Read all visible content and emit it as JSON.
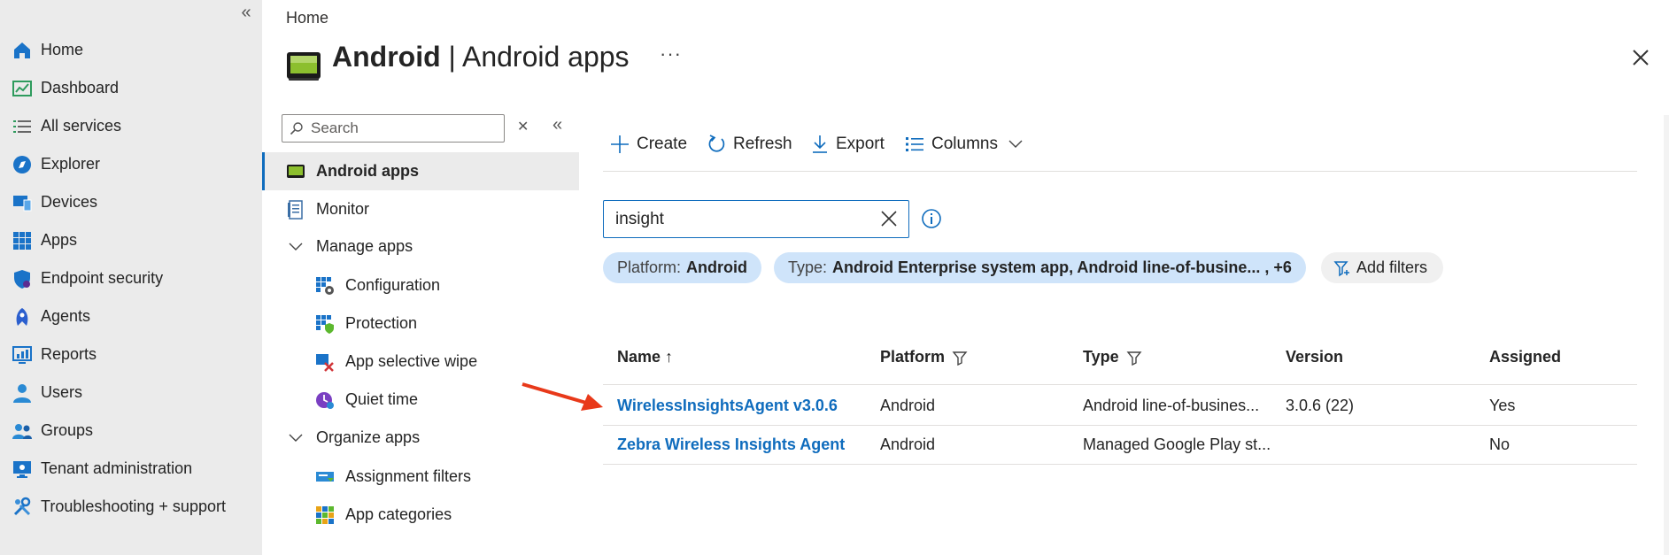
{
  "left_nav": {
    "collapse_icon": "chevron-double-left-icon",
    "items": [
      {
        "label": "Home",
        "icon": "home-icon"
      },
      {
        "label": "Dashboard",
        "icon": "dashboard-icon"
      },
      {
        "label": "All services",
        "icon": "list-icon"
      },
      {
        "label": "Explorer",
        "icon": "explorer-icon"
      },
      {
        "label": "Devices",
        "icon": "devices-icon"
      },
      {
        "label": "Apps",
        "icon": "apps-grid-icon"
      },
      {
        "label": "Endpoint security",
        "icon": "shield-icon"
      },
      {
        "label": "Agents",
        "icon": "agents-icon"
      },
      {
        "label": "Reports",
        "icon": "reports-icon"
      },
      {
        "label": "Users",
        "icon": "user-icon"
      },
      {
        "label": "Groups",
        "icon": "group-icon"
      },
      {
        "label": "Tenant administration",
        "icon": "tenant-icon"
      },
      {
        "label": "Troubleshooting + support",
        "icon": "wrench-icon"
      }
    ]
  },
  "header": {
    "breadcrumb": "Home",
    "title_bold": "Android",
    "title_rest": " | Android apps",
    "more": "···"
  },
  "menu": {
    "search_placeholder": "Search",
    "items": [
      {
        "label": "Android apps",
        "selected": true
      },
      {
        "label": "Monitor"
      },
      {
        "label": "Manage apps",
        "group": true
      },
      {
        "label": "Configuration"
      },
      {
        "label": "Protection"
      },
      {
        "label": "App selective wipe"
      },
      {
        "label": "Quiet time"
      },
      {
        "label": "Organize apps",
        "group": true
      },
      {
        "label": "Assignment filters"
      },
      {
        "label": "App categories"
      }
    ]
  },
  "toolbar": {
    "create": "Create",
    "refresh": "Refresh",
    "export": "Export",
    "columns": "Columns"
  },
  "filter": {
    "value": "insight",
    "pills": [
      {
        "key": "Platform:",
        "value": "Android"
      },
      {
        "key": "Type:",
        "value": "Android Enterprise system app, Android line-of-busine... , +6"
      }
    ],
    "add_filters": "Add filters"
  },
  "table": {
    "headers": [
      "Name ↑",
      "Platform",
      "Type",
      "Version",
      "Assigned"
    ],
    "rows": [
      {
        "name": "WirelessInsightsAgent v3.0.6",
        "platform": "Android",
        "type": "Android line-of-busines...",
        "version": "3.0.6 (22)",
        "assigned": "Yes"
      },
      {
        "name": "Zebra Wireless Insights Agent",
        "platform": "Android",
        "type": "Managed Google Play st...",
        "version": "",
        "assigned": "No"
      }
    ]
  },
  "colors": {
    "accent": "#0f6cbd",
    "arrow": "#e8391a",
    "pill_blue": "#cfe4fa",
    "nav_bg": "#ebebeb"
  }
}
